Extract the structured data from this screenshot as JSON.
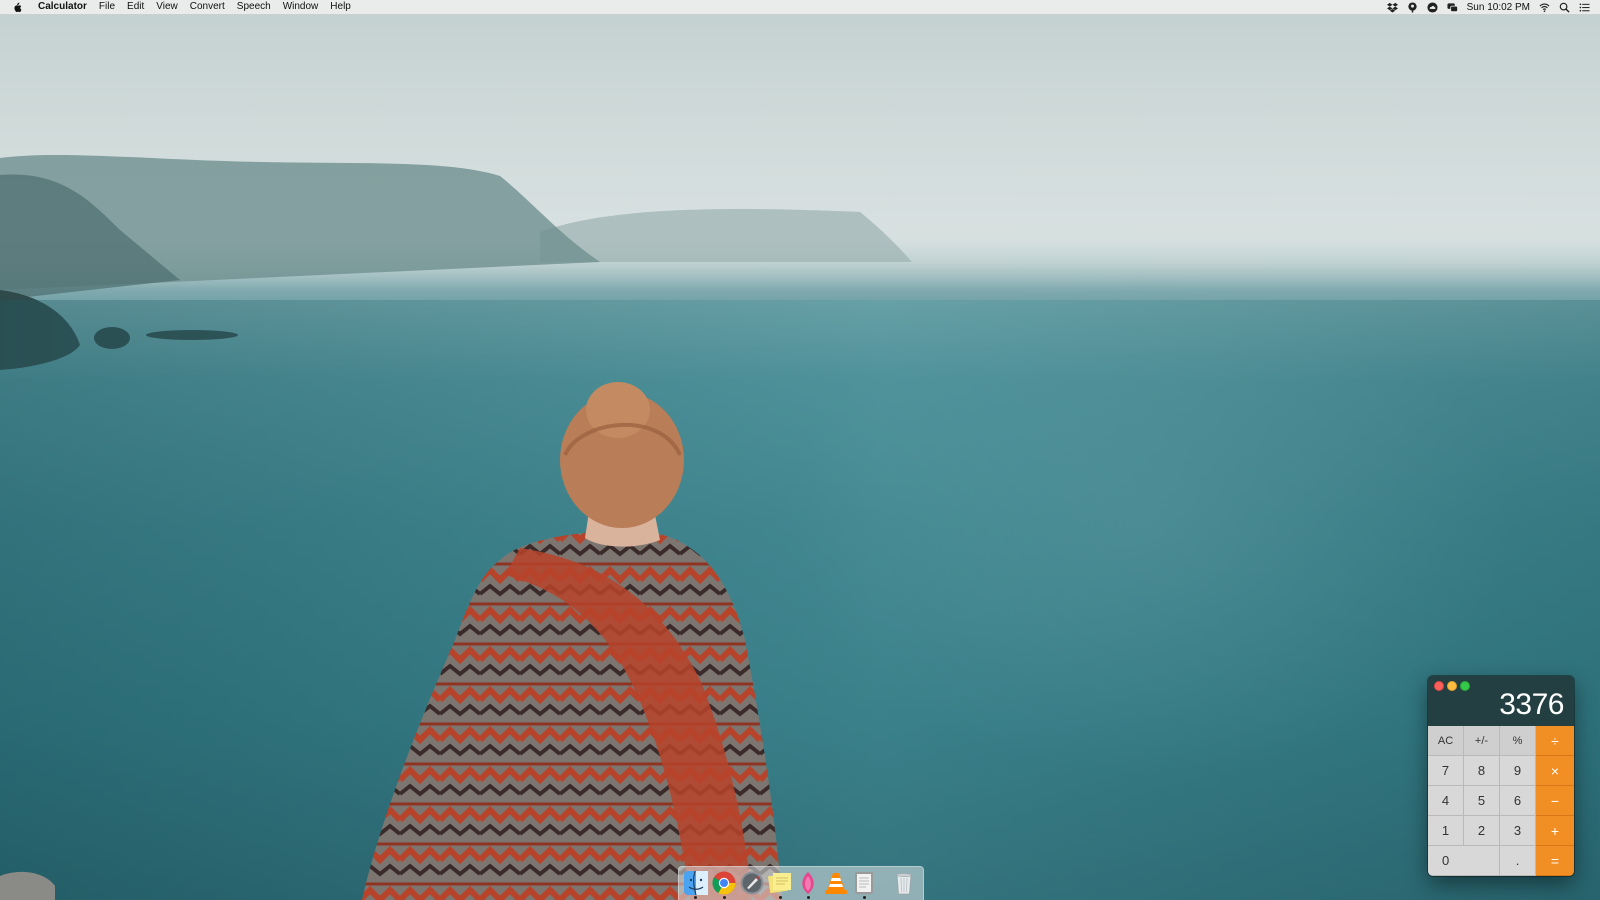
{
  "menubar": {
    "app_name": "Calculator",
    "menus": [
      "File",
      "Edit",
      "View",
      "Convert",
      "Speech",
      "Window",
      "Help"
    ],
    "clock": "Sun 10:02 PM",
    "tray_icons": [
      "dropbox-icon",
      "pin-icon",
      "cloud-icon",
      "messages-icon",
      "wifi-icon",
      "spotlight-search-icon",
      "notification-center-icon"
    ]
  },
  "calculator": {
    "display": "3376",
    "keys": {
      "ac": "AC",
      "plus_minus": "+/-",
      "percent": "%",
      "divide": "÷",
      "seven": "7",
      "eight": "8",
      "nine": "9",
      "multiply": "×",
      "four": "4",
      "five": "5",
      "six": "6",
      "minus": "−",
      "one": "1",
      "two": "2",
      "three": "3",
      "plus": "+",
      "zero": "0",
      "decimal": ".",
      "equals": "="
    },
    "colors": {
      "operator": "#f28f24",
      "display_bg": "#233e42"
    }
  },
  "dock": {
    "items": [
      "finder-icon",
      "chrome-icon",
      "launchpad-icon",
      "stickies-icon",
      "lotus-app-icon",
      "vlc-icon",
      "notes-app-icon",
      "trash-icon"
    ]
  }
}
